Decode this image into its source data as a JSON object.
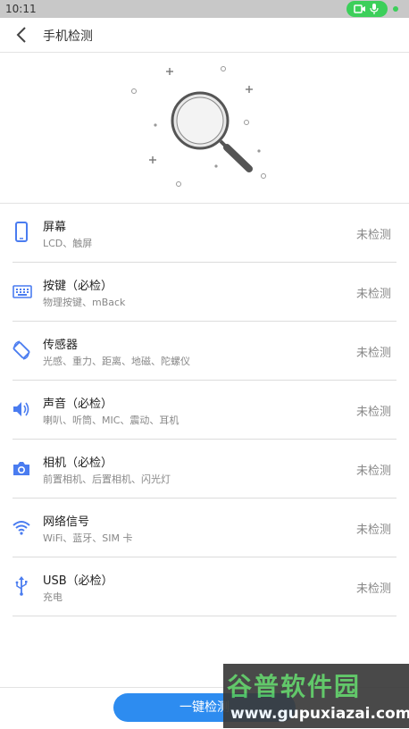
{
  "status_bar": {
    "time": "10:11"
  },
  "header": {
    "title": "手机检测"
  },
  "items": [
    {
      "icon": "phone-icon",
      "name": "屏幕",
      "desc": "LCD、触屏",
      "status": "未检测"
    },
    {
      "icon": "keyboard-icon",
      "name": "按键（必检）",
      "desc": "物理按键、mBack",
      "status": "未检测"
    },
    {
      "icon": "rotate-icon",
      "name": "传感器",
      "desc": "光感、重力、距离、地磁、陀螺仪",
      "status": "未检测"
    },
    {
      "icon": "speaker-icon",
      "name": "声音（必检）",
      "desc": "喇叭、听筒、MIC、震动、耳机",
      "status": "未检测"
    },
    {
      "icon": "camera-icon",
      "name": "相机（必检）",
      "desc": "前置相机、后置相机、闪光灯",
      "status": "未检测"
    },
    {
      "icon": "wifi-icon",
      "name": "网络信号",
      "desc": "WiFi、蓝牙、SIM 卡",
      "status": "未检测"
    },
    {
      "icon": "usb-icon",
      "name": "USB（必检）",
      "desc": "充电",
      "status": "未检测"
    }
  ],
  "action": {
    "label": "一键检测"
  },
  "watermark": {
    "main": "谷普软件园",
    "url": "www.gupuxiazai.com"
  },
  "colors": {
    "accent": "#2d8cf0",
    "icon": "#4a7cf0",
    "status_pill": "#3ccf5a"
  }
}
